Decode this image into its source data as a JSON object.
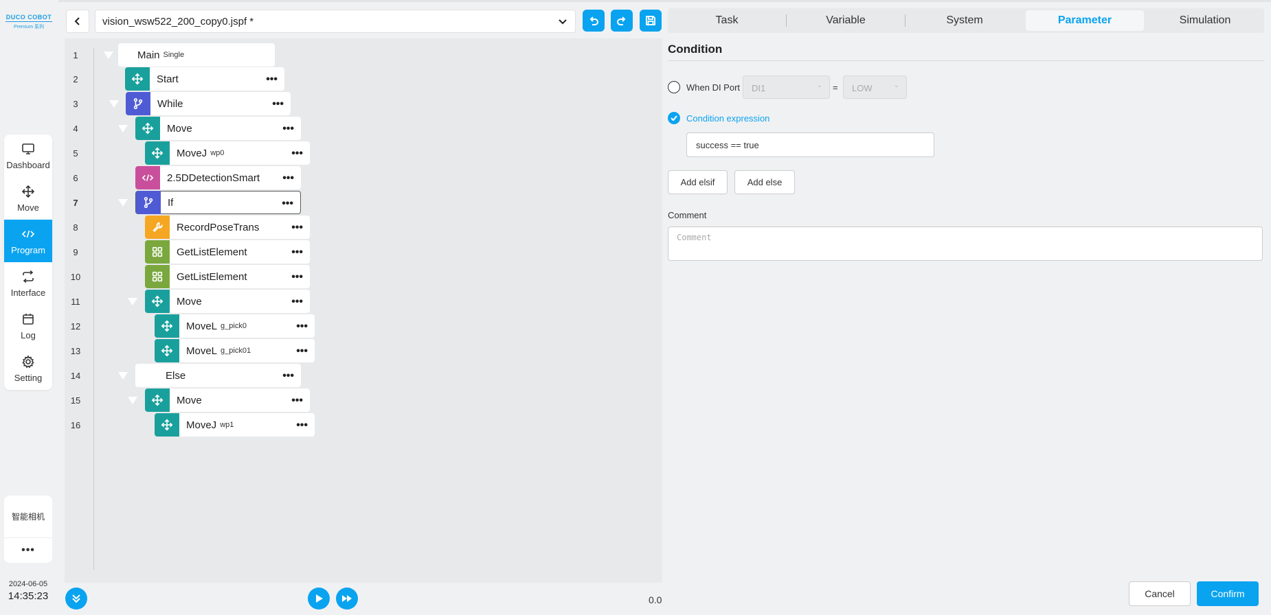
{
  "colors": {
    "accent": "#0aa3f0",
    "move": "#1aa09c",
    "flow": "#4f5bd5",
    "script": "#c94f9c",
    "record": "#f5a623",
    "list": "#7aa83e"
  },
  "sidebar": {
    "logo_main": "DUCO COBOT",
    "logo_sub": "Premium 系列",
    "items": [
      {
        "label": "Dashboard",
        "icon": "monitor-icon"
      },
      {
        "label": "Move",
        "icon": "move-arrows-icon"
      },
      {
        "label": "Program",
        "icon": "code-icon",
        "active": true
      },
      {
        "label": "Interface",
        "icon": "swap-icon"
      },
      {
        "label": "Log",
        "icon": "calendar-icon"
      },
      {
        "label": "Setting",
        "icon": "gear-icon"
      }
    ],
    "plugin_label": "智能相机",
    "more_label": "•••",
    "date": "2024-06-05",
    "time": "14:35:23"
  },
  "toolbar": {
    "file_name": "vision_wsw522_200_copy0.jspf *"
  },
  "tree": {
    "rows": [
      {
        "n": "1",
        "label": "Main",
        "sub": "Single"
      },
      {
        "n": "2",
        "label": "Start",
        "sub": ""
      },
      {
        "n": "3",
        "label": "While",
        "sub": ""
      },
      {
        "n": "4",
        "label": "Move",
        "sub": ""
      },
      {
        "n": "5",
        "label": "MoveJ",
        "sub": "wp0"
      },
      {
        "n": "6",
        "label": "2.5DDetectionSmart",
        "sub": ""
      },
      {
        "n": "7",
        "label": "If",
        "sub": ""
      },
      {
        "n": "8",
        "label": "RecordPoseTrans",
        "sub": ""
      },
      {
        "n": "9",
        "label": "GetListElement",
        "sub": ""
      },
      {
        "n": "10",
        "label": "GetListElement",
        "sub": ""
      },
      {
        "n": "11",
        "label": "Move",
        "sub": ""
      },
      {
        "n": "12",
        "label": "MoveL",
        "sub": "g_pick0"
      },
      {
        "n": "13",
        "label": "MoveL",
        "sub": "g_pick01"
      },
      {
        "n": "14",
        "label": "Else",
        "sub": ""
      },
      {
        "n": "15",
        "label": "Move",
        "sub": ""
      },
      {
        "n": "16",
        "label": "MoveJ",
        "sub": "wp1"
      }
    ],
    "dots": "•••",
    "speed": "0.0"
  },
  "tabs": [
    "Task",
    "Variable",
    "System",
    "Parameter",
    "Simulation"
  ],
  "condition": {
    "title": "Condition",
    "di_label": "When DI Port",
    "di_port": "DI1",
    "equals": "=",
    "di_level": "LOW",
    "expr_label": "Condition expression",
    "expr_value": "success == true",
    "add_elsif": "Add elsif",
    "add_else": "Add else",
    "comment_label": "Comment",
    "comment_placeholder": "Comment"
  },
  "footer": {
    "cancel": "Cancel",
    "confirm": "Confirm"
  }
}
